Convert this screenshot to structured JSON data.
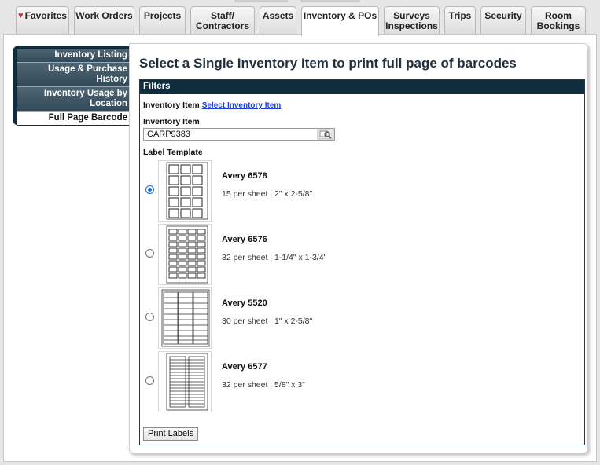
{
  "nav": {
    "tabs": [
      {
        "label": "Favorites",
        "icon": "heart-icon"
      },
      {
        "label": "Work Orders"
      },
      {
        "label": "Projects"
      },
      {
        "label": "Staff/\nContractors"
      },
      {
        "label": "Assets"
      },
      {
        "label": "Inventory & POs",
        "active": true
      },
      {
        "label": "Surveys\nInspections"
      },
      {
        "label": "Trips"
      },
      {
        "label": "Security"
      },
      {
        "label": "Room\nBookings"
      }
    ]
  },
  "sidebar": {
    "items": [
      {
        "label": "Inventory Listing"
      },
      {
        "label": "Usage & Purchase History"
      },
      {
        "label": "Inventory Usage by Location"
      },
      {
        "label": "Full Page Barcode",
        "active": true
      }
    ]
  },
  "main": {
    "title": "Select a Single Inventory Item to print full page of barcodes",
    "filters": {
      "header": "Filters",
      "item_label": "Inventory Item",
      "select_link": "Select Inventory Item",
      "field_label": "Inventory Item",
      "field_value": "CARP9383",
      "lookup_icon": "magnifier-lookup-icon",
      "template_label": "Label Template",
      "options": [
        {
          "name": "Avery 6578",
          "desc": "15 per sheet | 2\" x 2-5/8\"",
          "checked": true
        },
        {
          "name": "Avery 6576",
          "desc": "32 per sheet | 1-1/4\" x 1-3/4\"",
          "checked": false
        },
        {
          "name": "Avery 5520",
          "desc": "30 per sheet | 1\" x 2-5/8\"",
          "checked": false
        },
        {
          "name": "Avery 6577",
          "desc": "32 per sheet | 5/8\" x 3\"",
          "checked": false
        }
      ],
      "print_button": "Print Labels"
    }
  },
  "colors": {
    "nav_dark": "#102d3d",
    "link": "#1a3fd6",
    "radio_selected": "#1a6fdc",
    "heart": "#d32f2f"
  }
}
